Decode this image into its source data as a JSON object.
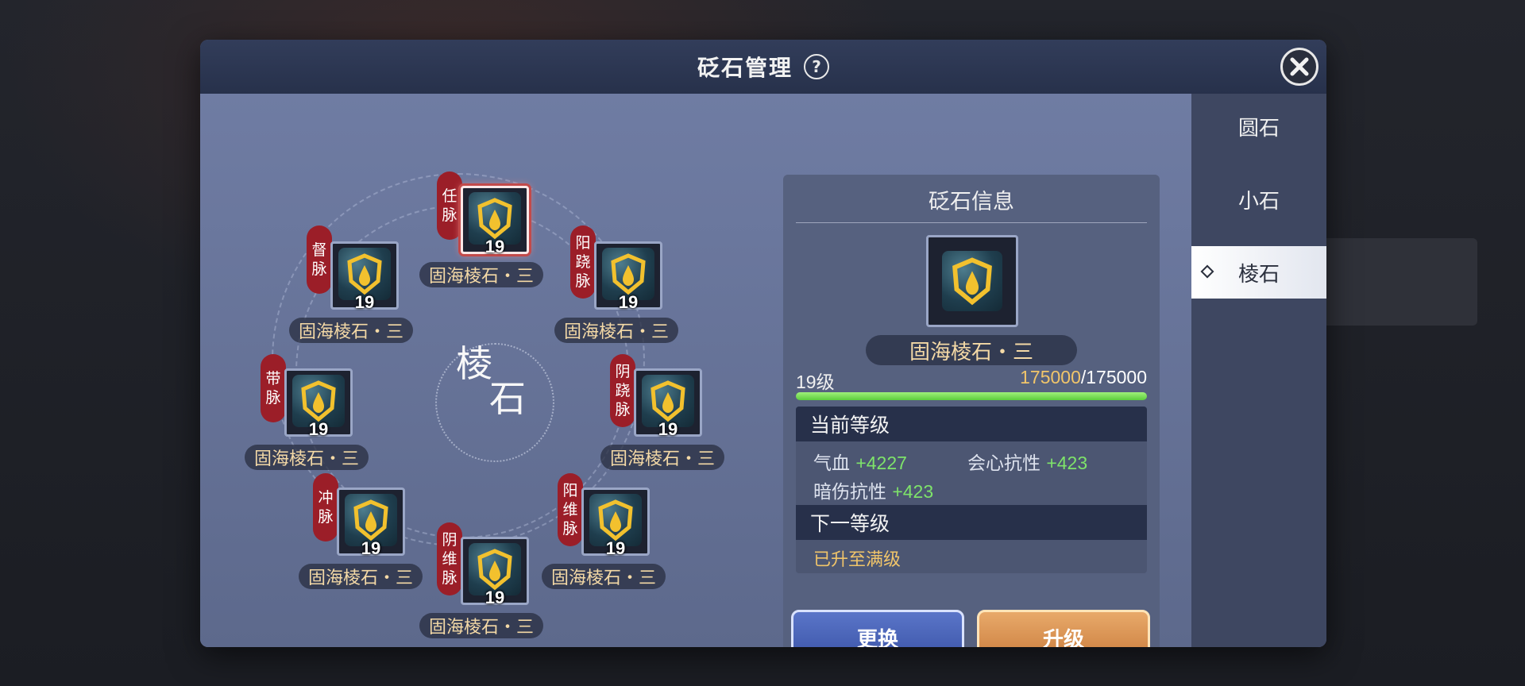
{
  "window": {
    "title": "砭石管理",
    "help_symbol": "?"
  },
  "tabs": [
    {
      "label": "圆石",
      "active": false
    },
    {
      "label": "小石",
      "active": false
    },
    {
      "label": "棱石",
      "active": true
    }
  ],
  "center": {
    "char1": "棱",
    "char2": "石"
  },
  "slots": [
    {
      "meridian": [
        "任",
        "脉"
      ],
      "level": "19",
      "name": "固海棱石・三",
      "selected": true
    },
    {
      "meridian": [
        "督",
        "脉"
      ],
      "level": "19",
      "name": "固海棱石・三",
      "selected": false
    },
    {
      "meridian": [
        "阳",
        "跷",
        "脉"
      ],
      "level": "19",
      "name": "固海棱石・三",
      "selected": false
    },
    {
      "meridian": [
        "带",
        "脉"
      ],
      "level": "19",
      "name": "固海棱石・三",
      "selected": false
    },
    {
      "meridian": [
        "阴",
        "跷",
        "脉"
      ],
      "level": "19",
      "name": "固海棱石・三",
      "selected": false
    },
    {
      "meridian": [
        "冲",
        "脉"
      ],
      "level": "19",
      "name": "固海棱石・三",
      "selected": false
    },
    {
      "meridian": [
        "阳",
        "维",
        "脉"
      ],
      "level": "19",
      "name": "固海棱石・三",
      "selected": false
    },
    {
      "meridian": [
        "阴",
        "维",
        "脉"
      ],
      "level": "19",
      "name": "固海棱石・三",
      "selected": false
    }
  ],
  "info": {
    "title": "砭石信息",
    "gem_name": "固海棱石・三",
    "level_text": "19级",
    "exp_current": "175000",
    "exp_total": "/175000",
    "exp_fraction": 1.0,
    "current_section": "当前等级",
    "stats": [
      {
        "label": "气血",
        "value": "+4227"
      },
      {
        "label": "会心抗性",
        "value": "+423"
      },
      {
        "label": "暗伤抗性",
        "value": "+423"
      }
    ],
    "next_section": "下一等级",
    "next_text": "已升至满级",
    "btn_replace": "更换",
    "btn_upgrade": "升级"
  },
  "colors": {
    "meridian_tag": "#9b1e28",
    "stat_value": "#7ee36a",
    "gem_name": "#f4d9a6",
    "exp_bar": "#5ccd3c"
  }
}
